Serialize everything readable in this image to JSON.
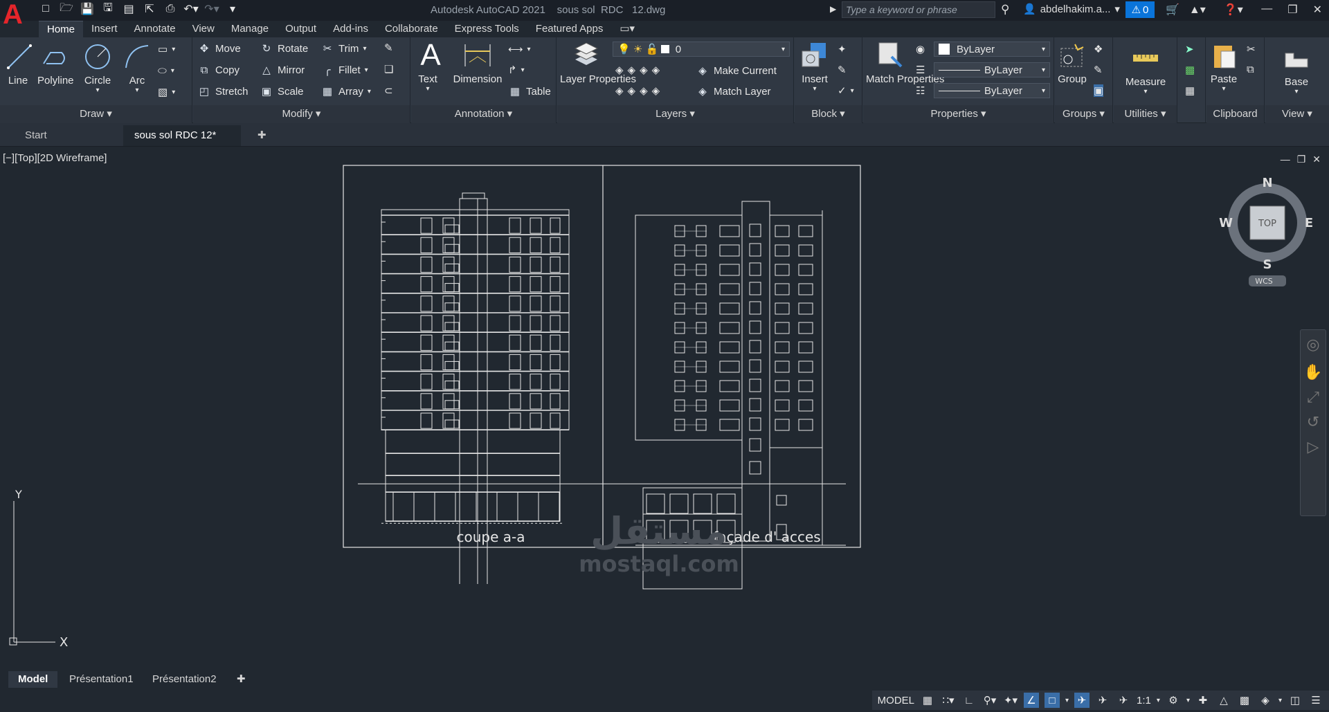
{
  "window": {
    "title": "Autodesk AutoCAD 2021    sous sol  RDC   12.dwg"
  },
  "search": {
    "placeholder": "Type a keyword or phrase"
  },
  "user": {
    "name": "abdelhakim.a..."
  },
  "notifications": {
    "count": "0"
  },
  "ribbon_tabs": [
    "Home",
    "Insert",
    "Annotate",
    "View",
    "Manage",
    "Output",
    "Add-ins",
    "Collaborate",
    "Express Tools",
    "Featured Apps"
  ],
  "draw": {
    "title": "Draw",
    "line": "Line",
    "polyline": "Polyline",
    "circle": "Circle",
    "arc": "Arc"
  },
  "modify": {
    "title": "Modify",
    "move": "Move",
    "rotate": "Rotate",
    "trim": "Trim",
    "copy": "Copy",
    "mirror": "Mirror",
    "fillet": "Fillet",
    "stretch": "Stretch",
    "scale": "Scale",
    "array": "Array"
  },
  "annotation": {
    "title": "Annotation",
    "text": "Text",
    "dimension": "Dimension",
    "table": "Table"
  },
  "layers": {
    "title": "Layers",
    "layer_properties": "Layer Properties",
    "current_layer": "0",
    "make_current": "Make Current",
    "match_layer": "Match Layer"
  },
  "block": {
    "title": "Block",
    "insert": "Insert"
  },
  "properties": {
    "title": "Properties",
    "match_properties": "Match Properties",
    "color": "ByLayer",
    "linetype": "ByLayer",
    "lineweight": "ByLayer"
  },
  "groups": {
    "title": "Groups",
    "group": "Group"
  },
  "utilities": {
    "title": "Utilities",
    "measure": "Measure"
  },
  "clipboard": {
    "title": "Clipboard",
    "paste": "Paste"
  },
  "view_panel": {
    "title": "View",
    "base": "Base"
  },
  "doc_tabs": {
    "start": "Start",
    "active": "sous sol  RDC   12*"
  },
  "viewport": {
    "label": "[−][Top][2D Wireframe]"
  },
  "viewcube": {
    "top": "TOP",
    "n": "N",
    "s": "S",
    "e": "E",
    "w": "W",
    "wcs": "WCS"
  },
  "drawing": {
    "left_caption": "coupe a-a",
    "right_caption": "façade d' acces",
    "floors_upper": 11
  },
  "ucs": {
    "x": "X",
    "y": "Y"
  },
  "layout_tabs": [
    "Model",
    "Présentation1",
    "Présentation2"
  ],
  "status": {
    "model": "MODEL",
    "scale": "1:1"
  },
  "watermark": {
    "text": "mostaql.com",
    "arabic": "مستقل"
  }
}
